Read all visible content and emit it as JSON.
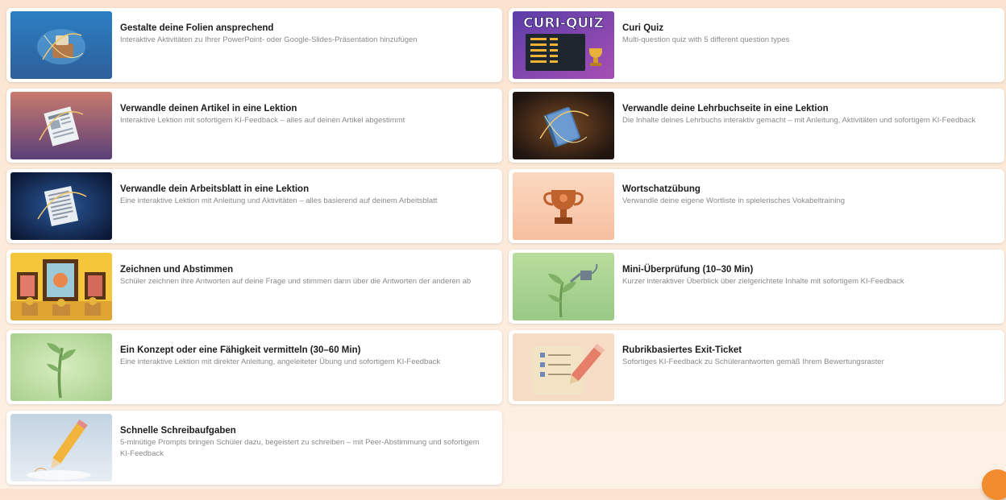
{
  "cards": [
    {
      "title": "Gestalte deine Folien ansprechend",
      "desc": "Interaktive Aktivitäten zu Ihrer PowerPoint- oder Google-Slides-Präsentation hinzufügen"
    },
    {
      "title": "Curi Quiz",
      "desc": "Multi-question quiz with 5 different question types",
      "thumb_text": "CURI-QUIZ"
    },
    {
      "title": "Verwandle deinen Artikel in eine Lektion",
      "desc": "Interaktive Lektion mit sofortigem KI-Feedback – alles auf deinen Artikel abgestimmt"
    },
    {
      "title": "Verwandle deine Lehrbuchseite in eine Lektion",
      "desc": "Die Inhalte deines Lehrbuchs interaktiv gemacht – mit Anleitung, Aktivitäten und sofortigem KI-Feedback"
    },
    {
      "title": "Verwandle dein Arbeitsblatt in eine Lektion",
      "desc": "Eine interaktive Lektion mit Anleitung und Aktivitäten – alles basierend auf deinem Arbeitsblatt"
    },
    {
      "title": "Wortschatzübung",
      "desc": "Verwandle deine eigene Wortliste in spielerisches Vokabeltraining"
    },
    {
      "title": "Zeichnen und Abstimmen",
      "desc": "Schüler zeichnen ihre Antworten auf deine Frage und stimmen dann über die Antworten der anderen ab"
    },
    {
      "title": "Mini-Überprüfung (10–30 Min)",
      "desc": "Kurzer interaktiver Überblick über zielgerichtete Inhalte mit sofortigem KI-Feedback"
    },
    {
      "title": "Ein Konzept oder eine Fähigkeit vermitteln (30–60 Min)",
      "desc": "Eine interaktive Lektion mit direkter Anleitung, angeleiteter Übung und sofortigem KI-Feedback"
    },
    {
      "title": "Rubrikbasiertes Exit-Ticket",
      "desc": "Sofortiges KI-Feedback zu Schülerantworten gemäß Ihrem Bewertungsraster"
    },
    {
      "title": "Schnelle Schreibaufgaben",
      "desc": "5-minütige Prompts bringen Schüler dazu, begeistert zu schreiben – mit Peer-Abstimmung und sofortigem KI-Feedback"
    }
  ],
  "colors": {
    "accent": "#f28a2e",
    "title": "#1c1c1c",
    "desc": "#8a8a8a"
  }
}
